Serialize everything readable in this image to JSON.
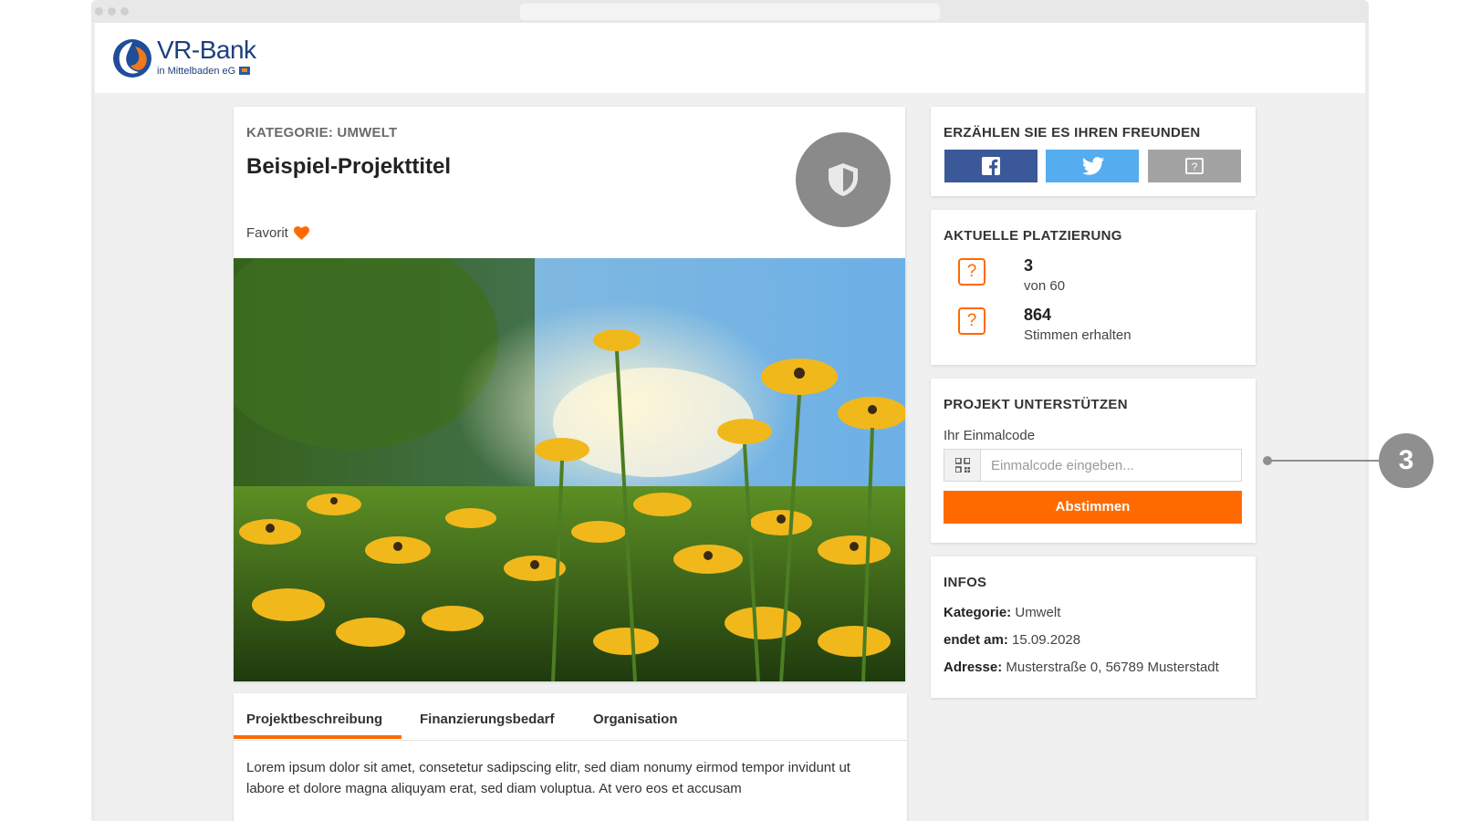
{
  "brand": {
    "name": "VR-Bank",
    "subtitle": "in Mittelbaden eG",
    "accent": "#ff6a00",
    "navy": "#1e3f7a"
  },
  "project": {
    "category_label": "KATEGORIE: UMWELT",
    "title": "Beispiel-Projekttitel",
    "favorite_label": "Favorit",
    "badge_icon": "shield-icon",
    "image_alt": "yellow-flowers-photo"
  },
  "tabs": [
    {
      "label": "Projektbeschreibung",
      "active": true
    },
    {
      "label": "Finanzierungsbedarf",
      "active": false
    },
    {
      "label": "Organisation",
      "active": false
    }
  ],
  "description": "Lorem ipsum dolor sit amet, consetetur sadipscing elitr, sed diam nonumy eirmod tempor invidunt ut labore et dolore magna aliquyam erat, sed diam voluptua. At vero eos et accusam",
  "share": {
    "heading": "ERZÄHLEN SIE ES IHREN FREUNDEN",
    "buttons": [
      {
        "network": "facebook",
        "icon": "facebook-icon",
        "color": "#3b5998"
      },
      {
        "network": "twitter",
        "icon": "twitter-icon",
        "color": "#55acee"
      },
      {
        "network": "unknown",
        "icon": "question-icon",
        "color": "#a3a3a3"
      }
    ]
  },
  "ranking": {
    "heading": "AKTUELLE PLATZIERUNG",
    "items": [
      {
        "value": "3",
        "label": "von 60",
        "icon": "question-icon"
      },
      {
        "value": "864",
        "label": "Stimmen erhalten",
        "icon": "question-icon"
      }
    ]
  },
  "support": {
    "heading": "PROJEKT UNTERSTÜTZEN",
    "field_label": "Ihr Einmalcode",
    "placeholder": "Einmalcode eingeben...",
    "value": "",
    "submit_label": "Abstimmen"
  },
  "infos": {
    "heading": "INFOS",
    "rows": [
      {
        "key": "Kategorie:",
        "value": "Umwelt"
      },
      {
        "key": "endet am:",
        "value": "15.09.2028"
      },
      {
        "key": "Adresse:",
        "value": "Musterstraße 0, 56789 Musterstadt"
      }
    ]
  },
  "callout": {
    "number": "3"
  }
}
